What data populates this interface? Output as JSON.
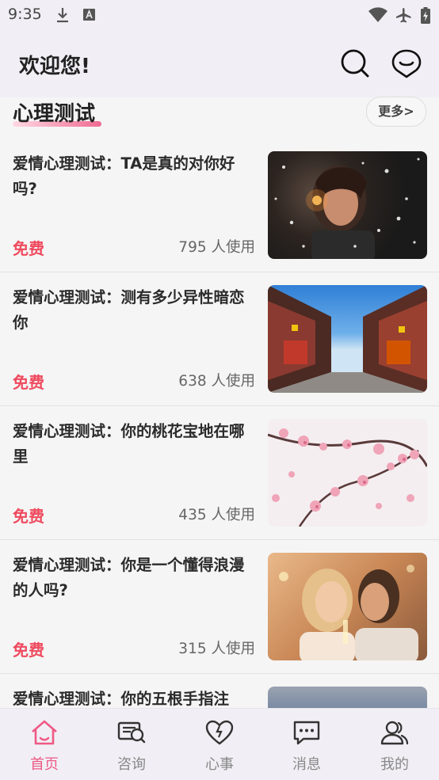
{
  "status_bar": {
    "time": "9:35",
    "icons": [
      "download-icon",
      "text-a-icon",
      "wifi-icon",
      "airplane-icon",
      "battery-charging-icon"
    ]
  },
  "header": {
    "title": "欢迎您!",
    "icons": [
      "search-icon",
      "smile-chat-icon"
    ]
  },
  "section": {
    "title": "心理测试",
    "more_label": "更多>"
  },
  "items": [
    {
      "title": "爱情心理测试：TA是真的对你好吗?",
      "price": "免费",
      "uses": "795 人使用"
    },
    {
      "title": "爱情心理测试：测有多少异性暗恋你",
      "price": "免费",
      "uses": "638 人使用"
    },
    {
      "title": "爱情心理测试：你的桃花宝地在哪里",
      "price": "免费",
      "uses": "435 人使用"
    },
    {
      "title": "爱情心理测试：你是一个懂得浪漫的人吗?",
      "price": "免费",
      "uses": "315 人使用"
    },
    {
      "title": "爱情心理测试：你的五根手指注",
      "price": "",
      "uses": ""
    }
  ],
  "tabs": [
    {
      "label": "首页",
      "icon": "home-icon",
      "active": true
    },
    {
      "label": "咨询",
      "icon": "consult-icon",
      "active": false
    },
    {
      "label": "心事",
      "icon": "heart-icon",
      "active": false
    },
    {
      "label": "消息",
      "icon": "message-icon",
      "active": false
    },
    {
      "label": "我的",
      "icon": "profile-icon",
      "active": false
    }
  ],
  "colors": {
    "accent": "#ef5a86",
    "price_red": "#ef4a5e",
    "header_bg": "#f1eff5",
    "list_bg": "#f5f5f5"
  }
}
